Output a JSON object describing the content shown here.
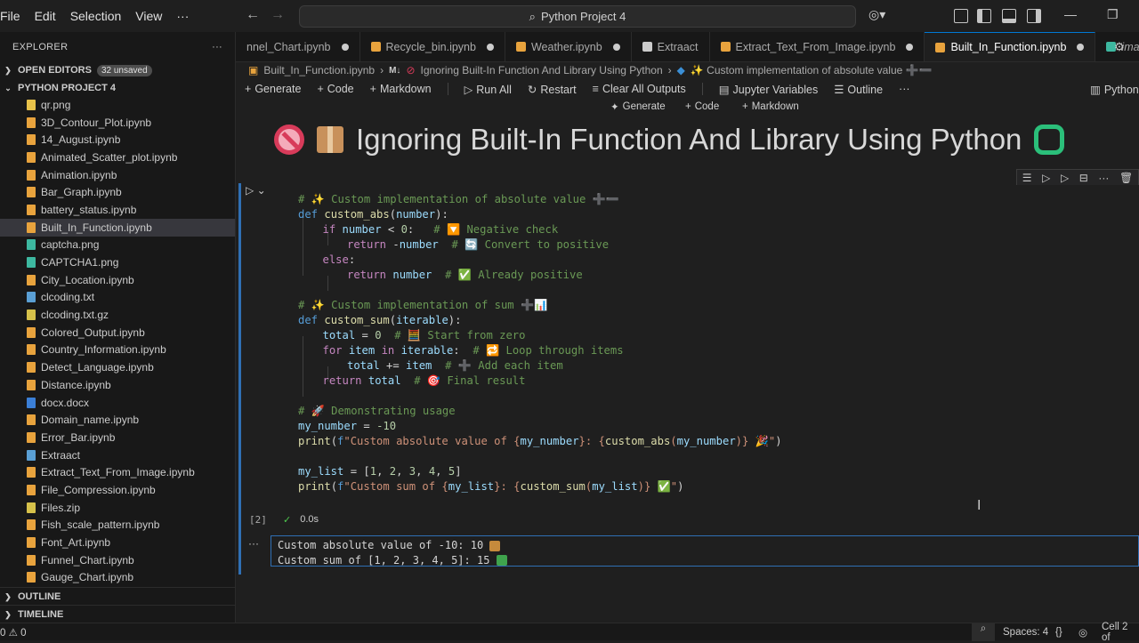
{
  "menu": [
    "File",
    "Edit",
    "Selection",
    "View",
    "···"
  ],
  "search": {
    "label": "Python Project 4"
  },
  "explorer": {
    "title": "EXPLORER",
    "more": "···",
    "open_editors": "OPEN EDITORS",
    "unsaved_badge": "32 unsaved",
    "project": "PYTHON PROJECT 4",
    "files": [
      {
        "name": "qr.png",
        "type": "folder"
      },
      {
        "name": "3D_Contour_Plot.ipynb",
        "type": "nb"
      },
      {
        "name": "14_August.ipynb",
        "type": "nb"
      },
      {
        "name": "Animated_Scatter_plot.ipynb",
        "type": "nb"
      },
      {
        "name": "Animation.ipynb",
        "type": "nb"
      },
      {
        "name": "Bar_Graph.ipynb",
        "type": "nb"
      },
      {
        "name": "battery_status.ipynb",
        "type": "nb"
      },
      {
        "name": "Built_In_Function.ipynb",
        "type": "nb"
      },
      {
        "name": "captcha.png",
        "type": "img"
      },
      {
        "name": "CAPTCHA1.png",
        "type": "img"
      },
      {
        "name": "City_Location.ipynb",
        "type": "nb"
      },
      {
        "name": "clcoding.txt",
        "type": "txt"
      },
      {
        "name": "clcoding.txt.gz",
        "type": "gz"
      },
      {
        "name": "Colored_Output.ipynb",
        "type": "nb"
      },
      {
        "name": "Country_Information.ipynb",
        "type": "nb"
      },
      {
        "name": "Detect_Language.ipynb",
        "type": "nb"
      },
      {
        "name": "Distance.ipynb",
        "type": "nb"
      },
      {
        "name": "docx.docx",
        "type": "doc"
      },
      {
        "name": "Domain_name.ipynb",
        "type": "nb"
      },
      {
        "name": "Error_Bar.ipynb",
        "type": "nb"
      },
      {
        "name": "Extraact",
        "type": "txt"
      },
      {
        "name": "Extract_Text_From_Image.ipynb",
        "type": "nb"
      },
      {
        "name": "File_Compression.ipynb",
        "type": "nb"
      },
      {
        "name": "Files.zip",
        "type": "gz"
      },
      {
        "name": "Fish_scale_pattern.ipynb",
        "type": "nb"
      },
      {
        "name": "Font_Art.ipynb",
        "type": "nb"
      },
      {
        "name": "Funnel_Chart.ipynb",
        "type": "nb"
      },
      {
        "name": "Gauge_Chart.ipynb",
        "type": "nb"
      }
    ],
    "active_file": "Built_In_Function.ipynb",
    "outline": "OUTLINE",
    "timeline": "TIMELINE"
  },
  "tabs": [
    {
      "label": "nnel_Chart.ipynb",
      "dirty": true,
      "color": "#e8a33d"
    },
    {
      "label": "Recycle_bin.ipynb",
      "dirty": true,
      "color": "#e8a33d"
    },
    {
      "label": "Weather.ipynb",
      "dirty": true,
      "color": "#e8a33d"
    },
    {
      "label": "Extraact",
      "dirty": false,
      "color": "#cccccc"
    },
    {
      "label": "Extract_Text_From_Image.ipynb",
      "dirty": true,
      "color": "#e8a33d"
    },
    {
      "label": "Built_In_Function.ipynb",
      "dirty": true,
      "color": "#e8a33d",
      "active": true
    },
    {
      "label": "images.jpeg",
      "dirty": false,
      "color": "#3db8a0"
    }
  ],
  "breadcrumb": {
    "file": "Built_In_Function.ipynb",
    "md": "M↓",
    "heading": "Ignoring Built-In Function And Library Using Python",
    "cell": "✨ Custom implementation of absolute value ➕➖"
  },
  "toolbar": {
    "generate": "Generate",
    "code": "Code",
    "markdown": "Markdown",
    "run_all": "Run All",
    "restart": "Restart",
    "clear": "Clear All Outputs",
    "variables": "Jupyter Variables",
    "outline": "Outline",
    "more": "···",
    "kernel": "Python"
  },
  "cell_add": {
    "generate": "Generate",
    "code": "Code",
    "markdown": "Markdown"
  },
  "markdown_title": "Ignoring Built-In Function And Library Using Python",
  "code_lines": [
    "# ✨ Custom implementation of absolute value ➕➖",
    "def custom_abs(number):",
    "if number < 0:   # 🔽 Negative check",
    "return -number  # 🔄 Convert to positive",
    "else:",
    "return number  # ✅ Already positive",
    "",
    "# ✨ Custom implementation of sum ➕📊",
    "def custom_sum(iterable):",
    "total = 0  # 🧮 Start from zero",
    "for item in iterable:  # 🔁 Loop through items",
    "total += item  # ➕ Add each item",
    "return total  # 🎯 Final result",
    "",
    "# 🚀 Demonstrating usage",
    "my_number = -10",
    "print(f\"Custom absolute value of {my_number}: {custom_abs(my_number)} 🎉\")",
    "",
    "my_list = [1, 2, 3, 4, 5]",
    "print(f\"Custom sum of {my_list}: {custom_sum(my_list)} ✅\")"
  ],
  "execution": {
    "count": "[2]",
    "time": "0.0s"
  },
  "output_dots": "···",
  "outputs": [
    "Custom absolute value of -10: 10",
    "Custom sum of [1, 2, 3, 4, 5]: 15"
  ],
  "status": {
    "left": "0 ⚠ 0",
    "spaces": "Spaces: 4",
    "braces": "{}",
    "cell": "Cell 2 of"
  }
}
